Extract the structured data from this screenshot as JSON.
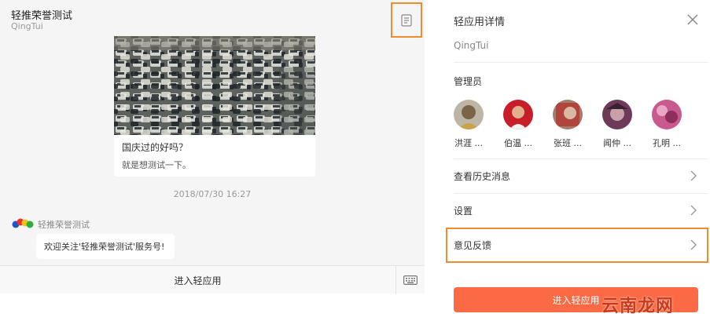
{
  "chat": {
    "title": "轻推荣誉测试",
    "subtitle": "QingTui",
    "article": {
      "title": "国庆过的好吗？",
      "desc": "就是想测试一下。"
    },
    "timestamp": "2018/07/30 16:27",
    "sender_name": "轻推荣誉测试",
    "message": "欢迎关注'轻推荣誉测试'服务号!",
    "enter_app_label": "进入轻应用"
  },
  "panel": {
    "title": "轻应用详情",
    "app_code": "QingTui",
    "admin_label": "管理员",
    "admins": [
      {
        "name": "洪涯 ..."
      },
      {
        "name": "伯温 ..."
      },
      {
        "name": "张班 ..."
      },
      {
        "name": "闻仲 ..."
      },
      {
        "name": "孔明 ..."
      }
    ],
    "rows": [
      {
        "label": "查看历史消息"
      },
      {
        "label": "设置"
      },
      {
        "label": "意见反馈"
      }
    ],
    "enter_button_label": "进入轻应用",
    "watermark": "云南龙网"
  },
  "colors": {
    "accent": "#fb6a44",
    "highlight": "#f08c30"
  },
  "icons": [
    "document-icon",
    "close-icon",
    "chevron-right-icon",
    "keyboard-icon"
  ]
}
